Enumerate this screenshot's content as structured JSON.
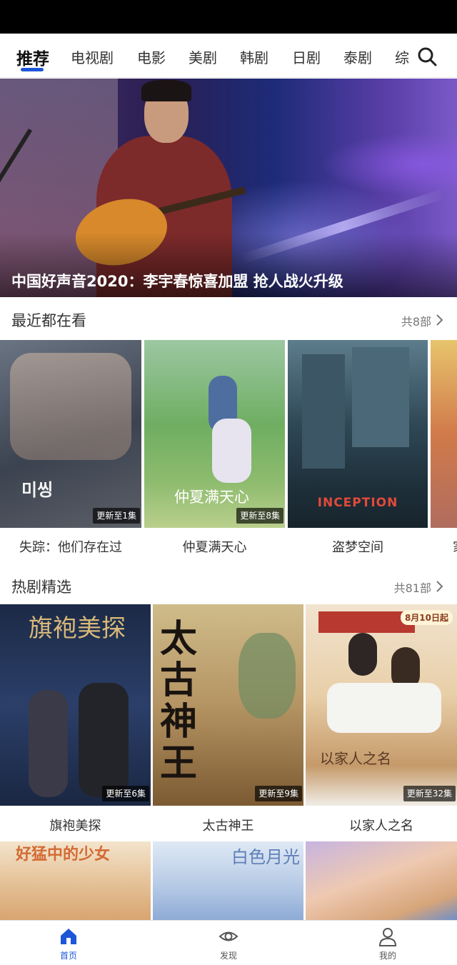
{
  "tabs": [
    "推荐",
    "电视剧",
    "电影",
    "美剧",
    "韩剧",
    "日剧",
    "泰剧",
    "综"
  ],
  "banner": {
    "title": "中国好声音2020：李宇春惊喜加盟 抢人战火升级"
  },
  "recent": {
    "title": "最近都在看",
    "count": "共8部",
    "items": [
      {
        "title": "失踪：他们存在过",
        "badge": "更新至1集",
        "poster_text": "미씽"
      },
      {
        "title": "仲夏满天心",
        "badge": "更新至8集",
        "poster_text": "仲夏满天心"
      },
      {
        "title": "盗梦空间",
        "badge": "",
        "poster_text": "INCEPTION"
      },
      {
        "title": "家",
        "badge": "",
        "poster_text": ""
      }
    ]
  },
  "hot": {
    "title": "热剧精选",
    "count": "共81部",
    "items": [
      {
        "title": "旗袍美探",
        "badge": "更新至6集",
        "poster_text": "旗袍美探"
      },
      {
        "title": "太古神王",
        "badge": "更新至9集",
        "poster_text": "太古神王"
      },
      {
        "title": "以家人之名",
        "badge": "更新至32集",
        "poster_text": "以家人之名",
        "date_tag": "8月10日起"
      }
    ]
  },
  "next_row": {
    "items": [
      {
        "poster_text": "好猛中的少女"
      },
      {
        "poster_text": "白色月光"
      },
      {
        "poster_text": ""
      }
    ]
  },
  "bottom_nav": [
    {
      "label": "首页",
      "icon": "home-icon",
      "active": true
    },
    {
      "label": "发现",
      "icon": "eye-icon",
      "active": false
    },
    {
      "label": "我的",
      "icon": "user-icon",
      "active": false
    }
  ],
  "colors": {
    "accent": "#1e56d8"
  }
}
